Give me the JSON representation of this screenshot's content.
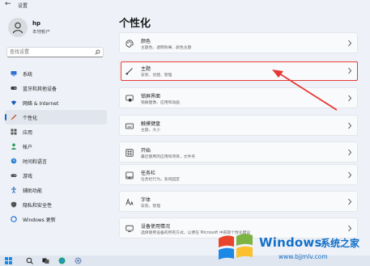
{
  "window": {
    "title": "设置"
  },
  "user": {
    "name": "hp",
    "account_type": "本地帐户"
  },
  "search": {
    "placeholder": "查找设置"
  },
  "nav": [
    {
      "label": "系统",
      "icon": "monitor-icon"
    },
    {
      "label": "蓝牙和其他设备",
      "icon": "bluetooth-icon"
    },
    {
      "label": "网络 & Internet",
      "icon": "wifi-icon"
    },
    {
      "label": "个性化",
      "icon": "brush-icon",
      "active": true
    },
    {
      "label": "应用",
      "icon": "apps-icon"
    },
    {
      "label": "帐户",
      "icon": "person-icon"
    },
    {
      "label": "时间和语言",
      "icon": "globe-clock-icon"
    },
    {
      "label": "游戏",
      "icon": "gamepad-icon"
    },
    {
      "label": "辅助功能",
      "icon": "accessibility-icon"
    },
    {
      "label": "隐私和安全性",
      "icon": "shield-icon"
    },
    {
      "label": "Windows 更新",
      "icon": "update-icon"
    }
  ],
  "page": {
    "title": "个性化"
  },
  "cards": [
    {
      "title": "颜色",
      "subtitle": "主题色、透明效果、颜色主题",
      "icon": "palette-icon"
    },
    {
      "title": "主题",
      "subtitle": "安装、创建、管理",
      "icon": "brush-icon",
      "highlighted": true
    },
    {
      "title": "锁屏界面",
      "subtitle": "锁屏图像、应用和动画",
      "icon": "lock-screen-icon"
    },
    {
      "title": "触摸键盘",
      "subtitle": "主题，大小",
      "icon": "keyboard-icon"
    },
    {
      "title": "开始",
      "subtitle": "最近使用的应用和项目，文件夹",
      "icon": "start-icon"
    },
    {
      "title": "任务栏",
      "subtitle": "任务栏行为，系统固定",
      "icon": "taskbar-icon"
    },
    {
      "title": "字体",
      "subtitle": "安装，管理",
      "icon": "font-icon"
    },
    {
      "title": "设备使用情况",
      "subtitle": "选择使用设备的所有方式，以便在 Microsoft 中获取个性化建议",
      "icon": "device-usage-icon"
    }
  ],
  "watermark": {
    "brand": "Windows",
    "site_name": "系统之家",
    "url": "www.bjjmlv.com"
  },
  "colors": {
    "accent": "#1a67c4",
    "highlight": "#e53935",
    "watermark": "#1470c8"
  }
}
